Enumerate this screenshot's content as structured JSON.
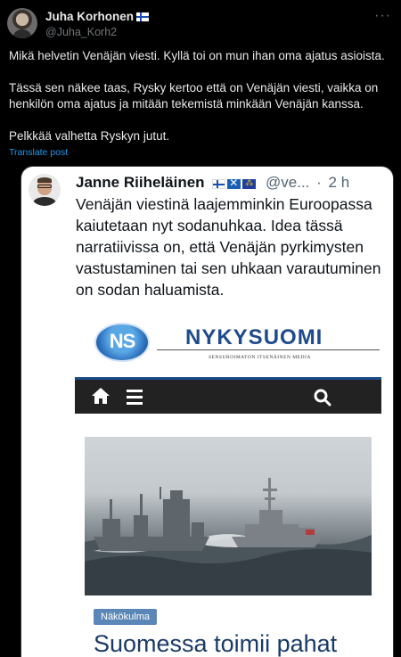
{
  "outer_post": {
    "author_name": "Juha Korhonen",
    "author_flag": "Finland flag",
    "handle": "@Juha_Korh2",
    "paragraphs": [
      "Mikä helvetin Venäjän viesti. Kyllä toi on mun ihan oma ajatus asioista.",
      "Tässä sen näkee taas, Rysky kertoo että on Venäjän viesti, vaikka on henkilön oma ajatus ja mitään tekemistä minkään Venäjän kanssa.",
      "Pelkkää valhetta Ryskyn jutut."
    ],
    "translate_label": "Translate post",
    "more_icon": "more-horizontal-icon"
  },
  "quoted_post": {
    "author_name": "Janne Riiheläinen",
    "flags": [
      "Finland flag",
      "Scotland flag",
      "EU flag"
    ],
    "handle": "@ve...",
    "separator": "·",
    "time": "2 h",
    "text": "Venäjän viestinä laajemminkin Euroopassa kaiutetaan nyt sodanuhkaa. Idea tässä narratiivissa on, että Venäjän pyrkimysten vastustaminen tai sen uhkaan varautuminen on sodan haluamista."
  },
  "article_image": {
    "logo_text": "NS",
    "brand": "NYKYSUOMI",
    "tagline": "SENSUROIMATON ITSENÄINEN MEDIA",
    "nav_icons": [
      "home-icon",
      "menu-icon",
      "search-icon"
    ],
    "category": "Näkökulma",
    "headline": "Suomessa toimii pahat"
  },
  "colors": {
    "background": "#000000",
    "link": "#1d9bf0",
    "muted": "#71767b",
    "brand_blue": "#1f4a8c",
    "nav_dark": "#222222"
  }
}
